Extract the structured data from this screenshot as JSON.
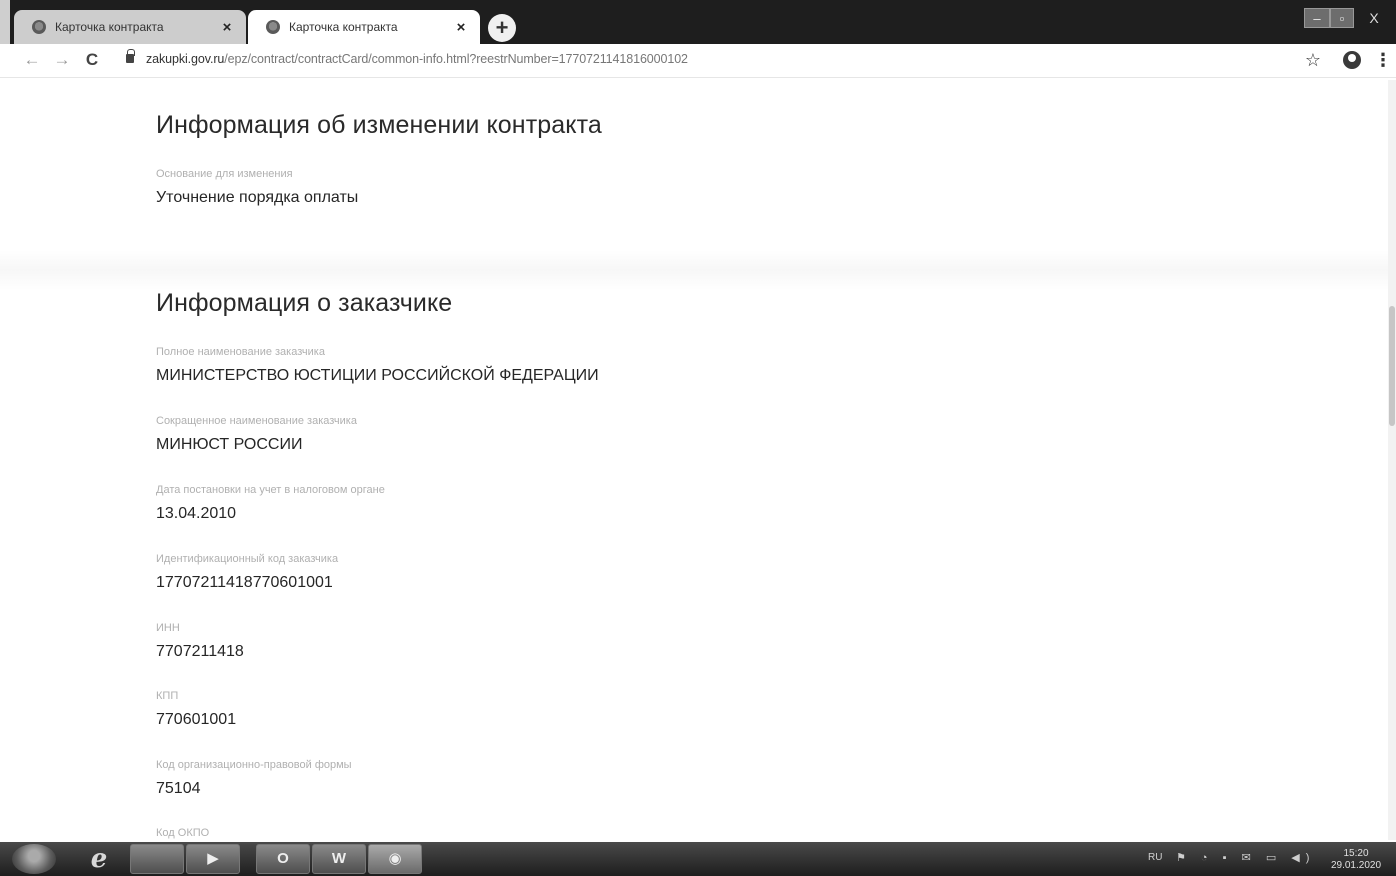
{
  "browser": {
    "tabs": [
      {
        "title": "Карточка контракта",
        "close": "×"
      },
      {
        "title": "Карточка контракта",
        "close": "×"
      }
    ],
    "new_tab": "+",
    "window_controls": {
      "minimize": "–",
      "maximize": "▫",
      "close": "X"
    },
    "nav": {
      "back": "←",
      "forward": "→",
      "reload": "C"
    },
    "url_host": "zakupki.gov.ru",
    "url_path": "/epz/contract/contractCard/common-info.html?reestrNumber=1770721141816000102",
    "star": "☆",
    "menu": "⋮"
  },
  "page": {
    "change_section": {
      "title": "Информация об изменении контракта",
      "fields": [
        {
          "label": "Основание для изменения",
          "value": "Уточнение порядка оплаты"
        }
      ]
    },
    "customer_section": {
      "title": "Информация о заказчике",
      "fields": [
        {
          "label": "Полное наименование заказчика",
          "value": "МИНИСТЕРСТВО ЮСТИЦИИ РОССИЙСКОЙ ФЕДЕРАЦИИ"
        },
        {
          "label": "Сокращенное наименование заказчика",
          "value": "МИНЮСТ РОССИИ"
        },
        {
          "label": "Дата постановки на учет в налоговом органе",
          "value": "13.04.2010"
        },
        {
          "label": "Идентификационный код заказчика",
          "value": "17707211418770601001"
        },
        {
          "label": "ИНН",
          "value": "7707211418"
        },
        {
          "label": "КПП",
          "value": "770601001"
        },
        {
          "label": "Код организационно-правовой формы",
          "value": "75104"
        },
        {
          "label": "Код ОКПО",
          "value": ""
        }
      ]
    }
  },
  "taskbar": {
    "apps": {
      "ie": "e",
      "media": "▶",
      "outlook": "O",
      "word": "W",
      "chrome": "◉"
    },
    "lang": "RU",
    "clock_time": "15:20",
    "clock_date": "29.01.2020"
  }
}
